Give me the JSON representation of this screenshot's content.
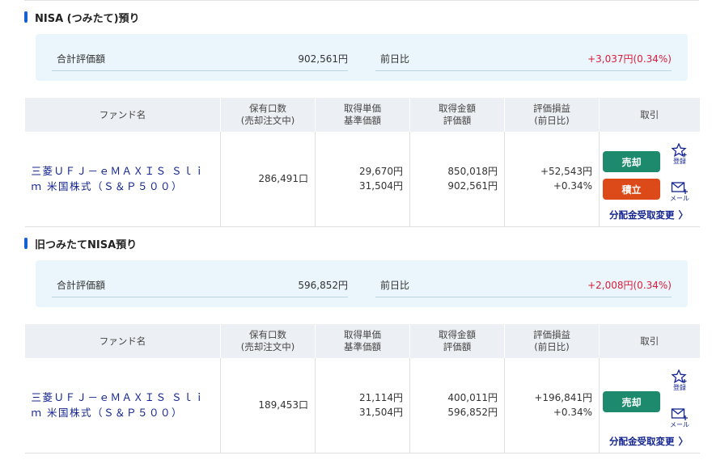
{
  "sections": [
    {
      "title": "NISA (つみたて)預り",
      "summary": {
        "total_label": "合計評価額",
        "total_value": "902,561円",
        "change_label": "前日比",
        "change_value": "+3,037円(0.34%)"
      },
      "headers": {
        "fund": "ファンド名",
        "units_1": "保有口数",
        "units_2": "(売却注文中)",
        "price_1": "取得単価",
        "price_2": "基準価額",
        "amount_1": "取得金額",
        "amount_2": "評価額",
        "pl_1": "評価損益",
        "pl_2": "(前日比)",
        "trade": "取引"
      },
      "row": {
        "fund_name": "三菱ＵＦＪ－ｅＭＡＸＩＳ Ｓｌｉｍ 米国株式（Ｓ＆Ｐ５００）",
        "units": "286,491口",
        "acq_price": "29,670円",
        "base_price": "31,504円",
        "acq_amount": "850,018円",
        "eval_amount": "902,561円",
        "pl": "+52,543円",
        "pl_pct": "+0.34%",
        "sell_label": "売却",
        "accum_label": "積立",
        "register_label": "登録",
        "mail_label": "メール",
        "dist_label": "分配金受取変更"
      }
    },
    {
      "title": "旧つみたてNISA預り",
      "summary": {
        "total_label": "合計評価額",
        "total_value": "596,852円",
        "change_label": "前日比",
        "change_value": "+2,008円(0.34%)"
      },
      "headers": {
        "fund": "ファンド名",
        "units_1": "保有口数",
        "units_2": "(売却注文中)",
        "price_1": "取得単価",
        "price_2": "基準価額",
        "amount_1": "取得金額",
        "amount_2": "評価額",
        "pl_1": "評価損益",
        "pl_2": "(前日比)",
        "trade": "取引"
      },
      "row": {
        "fund_name": "三菱ＵＦＪ－ｅＭＡＸＩＳ Ｓｌｉｍ 米国株式（Ｓ＆Ｐ５００）",
        "units": "189,453口",
        "acq_price": "21,114円",
        "base_price": "31,504円",
        "acq_amount": "400,011円",
        "eval_amount": "596,852円",
        "pl": "+196,841円",
        "pl_pct": "+0.34%",
        "sell_label": "売却",
        "register_label": "登録",
        "mail_label": "メール",
        "dist_label": "分配金受取変更"
      }
    }
  ],
  "colors": {
    "accent_bar": "#1560d6",
    "link": "#14248f",
    "gain": "#d81e3c",
    "sell_button": "#1d8a6e",
    "accumulate_button": "#dc4a1a",
    "summary_bg": "#eaf6fb"
  },
  "icons": {
    "register": "star-plus-icon",
    "mail": "mail-plus-icon",
    "distribution": "chevron-right-icon"
  }
}
